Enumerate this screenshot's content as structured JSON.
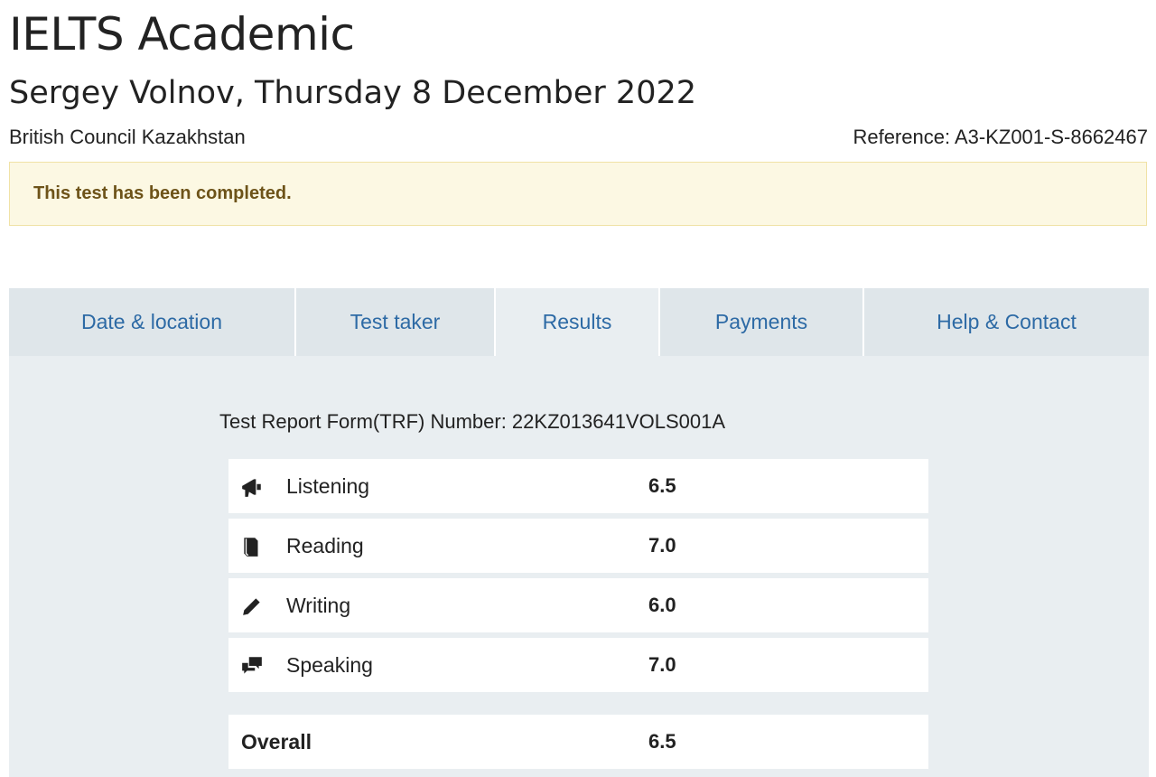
{
  "header": {
    "title": "IELTS Academic",
    "subtitle": "Sergey Volnov, Thursday 8 December 2022",
    "centre": "British Council Kazakhstan",
    "reference": "Reference: A3-KZ001-S-8662467"
  },
  "alert": {
    "message": "This test has been completed."
  },
  "tabs": [
    {
      "label": "Date & location",
      "active": false
    },
    {
      "label": "Test taker",
      "active": false
    },
    {
      "label": "Results",
      "active": true
    },
    {
      "label": "Payments",
      "active": false
    },
    {
      "label": "Help & Contact",
      "active": false
    }
  ],
  "results": {
    "trf": "Test Report Form(TRF) Number: 22KZ013641VOLS001A",
    "rows": [
      {
        "icon": "megaphone-icon",
        "label": "Listening",
        "score": "6.5"
      },
      {
        "icon": "book-icon",
        "label": "Reading",
        "score": "7.0"
      },
      {
        "icon": "pencil-icon",
        "label": "Writing",
        "score": "6.0"
      },
      {
        "icon": "speech-bubbles-icon",
        "label": "Speaking",
        "score": "7.0"
      }
    ],
    "overall": {
      "label": "Overall",
      "score": "6.5"
    }
  },
  "colors": {
    "tab_text": "#2d6aa5",
    "alert_bg": "#fcf8e3",
    "alert_text": "#6d5319",
    "panel_bg": "#e9eef1"
  }
}
